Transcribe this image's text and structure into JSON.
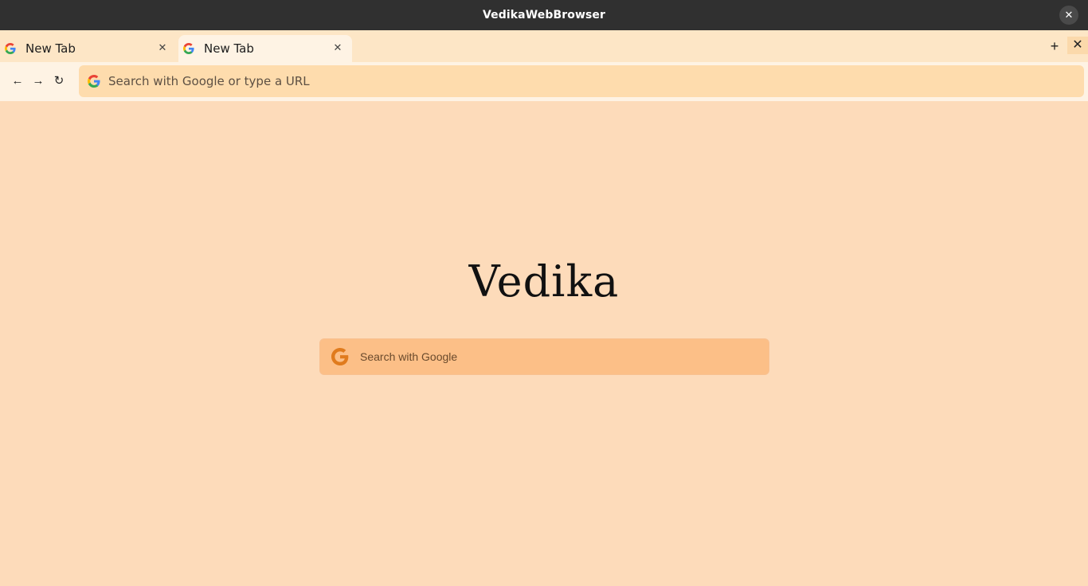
{
  "window": {
    "title": "VedikaWebBrowser",
    "close_symbol": "✕"
  },
  "tabs": [
    {
      "label": "New Tab",
      "icon": "google-g-icon",
      "close_symbol": "✕",
      "active": false
    },
    {
      "label": "New Tab",
      "icon": "google-g-icon",
      "close_symbol": "✕",
      "active": true
    }
  ],
  "tabstrip": {
    "new_tab_symbol": "+",
    "close_symbol": "✕"
  },
  "nav": {
    "back_symbol": "←",
    "forward_symbol": "→",
    "reload_symbol": "↻"
  },
  "urlbar": {
    "placeholder": "Search with Google or type a URL",
    "value": ""
  },
  "home": {
    "brand": "Vedika",
    "search_placeholder": "Search with Google"
  },
  "colors": {
    "titlebar": "#303030",
    "tabstrip": "#fde6c6",
    "active_tab": "#fef3e4",
    "urlbar": "#fedcad",
    "page_background": "#fddbba",
    "search_box": "#fcbf87",
    "search_icon": "#e07b1d"
  }
}
